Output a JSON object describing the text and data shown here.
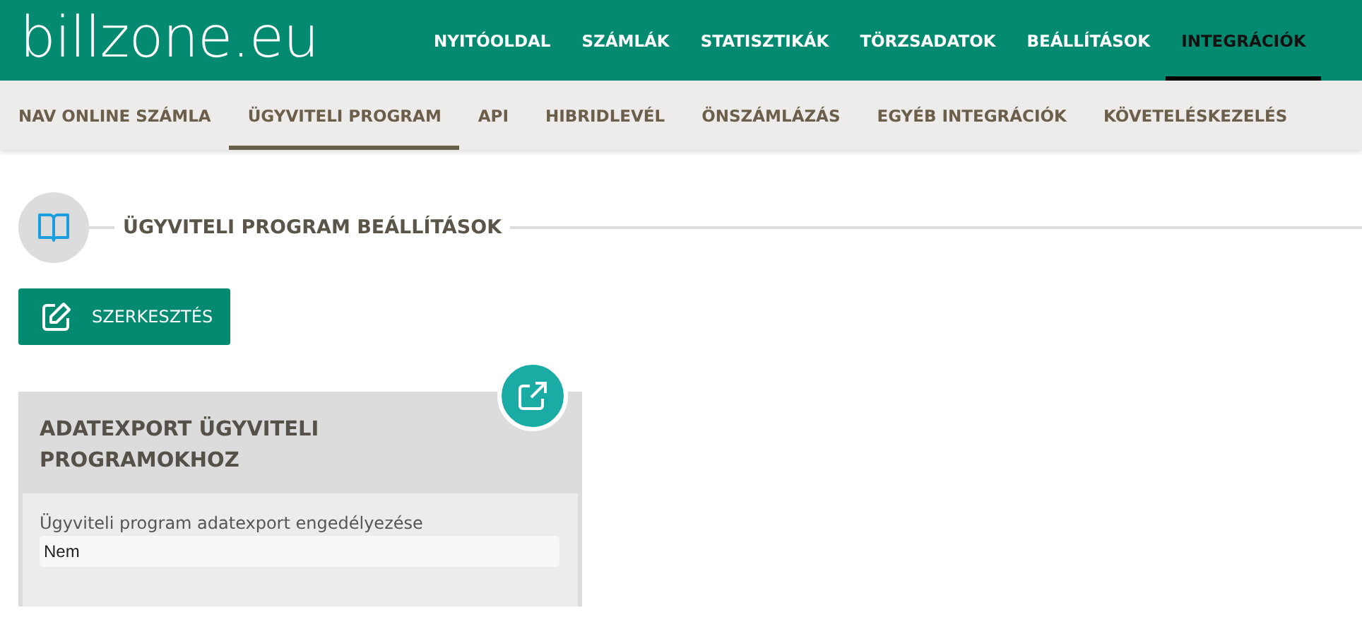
{
  "logo": "billzone.eu",
  "main_nav": [
    {
      "label": "NYITÓOLDAL",
      "selected": false
    },
    {
      "label": "SZÁMLÁK",
      "selected": false
    },
    {
      "label": "STATISZTIKÁK",
      "selected": false
    },
    {
      "label": "TÖRZSADATOK",
      "selected": false
    },
    {
      "label": "BEÁLLÍTÁSOK",
      "selected": false
    },
    {
      "label": "INTEGRÁCIÓK",
      "selected": true
    }
  ],
  "sub_nav": [
    {
      "label": "NAV ONLINE SZÁMLA",
      "selected": false
    },
    {
      "label": "ÜGYVITELI PROGRAM",
      "selected": true
    },
    {
      "label": "API",
      "selected": false
    },
    {
      "label": "HIBRIDLEVÉL",
      "selected": false
    },
    {
      "label": "ÖNSZÁMLÁZÁS",
      "selected": false
    },
    {
      "label": "EGYÉB INTEGRÁCIÓK",
      "selected": false
    },
    {
      "label": "KÖVETELÉSKEZELÉS",
      "selected": false
    }
  ],
  "section_title": "ÜGYVITELI PROGRAM BEÁLLÍTÁSOK",
  "edit_button": "SZERKESZTÉS",
  "card": {
    "title": "ADATEXPORT ÜGYVITELI PROGRAMOKHOZ",
    "fields": [
      {
        "label": "Ügyviteli program adatexport engedélyezése",
        "value": "Nem"
      }
    ]
  }
}
